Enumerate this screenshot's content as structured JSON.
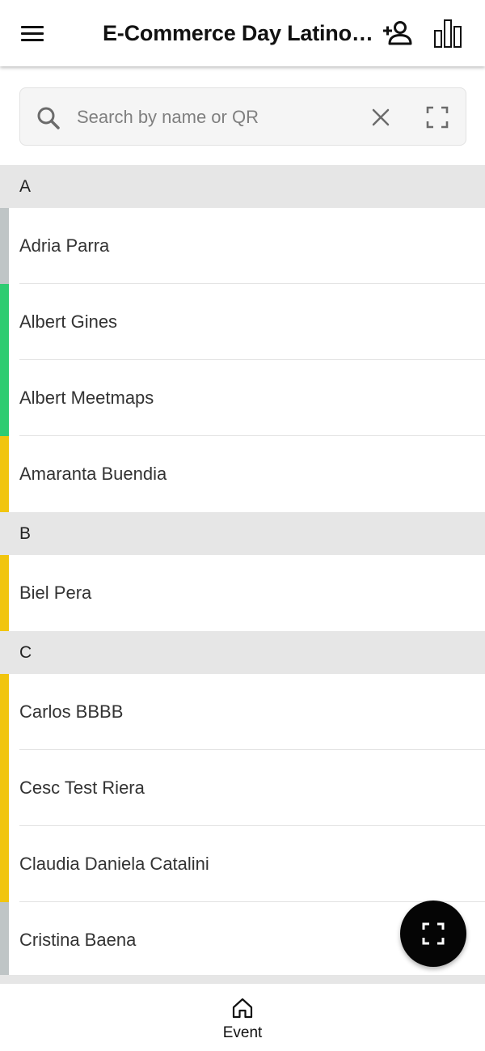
{
  "appbar": {
    "title": "E-Commerce Day Latino…",
    "menu_icon": "hamburger-menu-icon",
    "add_person_icon": "person-add-icon",
    "stats_icon": "bar-chart-icon"
  },
  "search": {
    "placeholder": "Search by name or QR",
    "value": "",
    "search_icon": "search-icon",
    "clear_icon": "close-icon",
    "scan_icon": "qr-scan-icon"
  },
  "colors": {
    "grey": "#bfc5c6",
    "green": "#2ecc71",
    "yellow": "#f1c50e"
  },
  "sections": [
    {
      "letter": "A",
      "attendees": [
        {
          "name": "Adria Parra",
          "status_color": "#bfc5c6"
        },
        {
          "name": "Albert Gines",
          "status_color": "#2ecc71"
        },
        {
          "name": "Albert Meetmaps",
          "status_color": "#2ecc71"
        },
        {
          "name": "Amaranta Buendia",
          "status_color": "#f1c50e"
        }
      ]
    },
    {
      "letter": "B",
      "attendees": [
        {
          "name": "Biel Pera",
          "status_color": "#f1c50e"
        }
      ]
    },
    {
      "letter": "C",
      "attendees": [
        {
          "name": "Carlos BBBB",
          "status_color": "#f1c50e"
        },
        {
          "name": "Cesc Test Riera",
          "status_color": "#f1c50e"
        },
        {
          "name": "Claudia Daniela Catalini",
          "status_color": "#f1c50e"
        },
        {
          "name": "Cristina Baena",
          "status_color": "#bfc5c6"
        }
      ]
    }
  ],
  "fab": {
    "icon": "qr-scan-icon"
  },
  "bottom_nav": {
    "items": [
      {
        "label": "Event",
        "icon": "home-icon"
      }
    ]
  }
}
